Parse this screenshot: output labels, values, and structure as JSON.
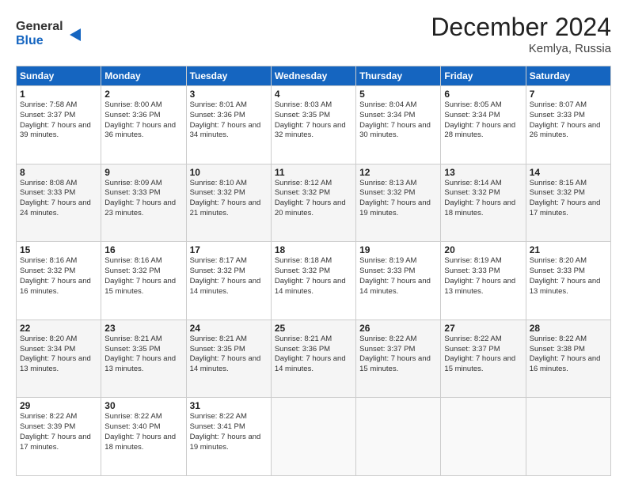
{
  "header": {
    "title": "December 2024",
    "location": "Kemlya, Russia",
    "logo_general": "General",
    "logo_blue": "Blue"
  },
  "weekdays": [
    "Sunday",
    "Monday",
    "Tuesday",
    "Wednesday",
    "Thursday",
    "Friday",
    "Saturday"
  ],
  "weeks": [
    [
      {
        "day": "1",
        "sr": "7:58 AM",
        "ss": "3:37 PM",
        "dl": "7 hours and 39 minutes."
      },
      {
        "day": "2",
        "sr": "8:00 AM",
        "ss": "3:36 PM",
        "dl": "7 hours and 36 minutes."
      },
      {
        "day": "3",
        "sr": "8:01 AM",
        "ss": "3:36 PM",
        "dl": "7 hours and 34 minutes."
      },
      {
        "day": "4",
        "sr": "8:03 AM",
        "ss": "3:35 PM",
        "dl": "7 hours and 32 minutes."
      },
      {
        "day": "5",
        "sr": "8:04 AM",
        "ss": "3:34 PM",
        "dl": "7 hours and 30 minutes."
      },
      {
        "day": "6",
        "sr": "8:05 AM",
        "ss": "3:34 PM",
        "dl": "7 hours and 28 minutes."
      },
      {
        "day": "7",
        "sr": "8:07 AM",
        "ss": "3:33 PM",
        "dl": "7 hours and 26 minutes."
      }
    ],
    [
      {
        "day": "8",
        "sr": "8:08 AM",
        "ss": "3:33 PM",
        "dl": "7 hours and 24 minutes."
      },
      {
        "day": "9",
        "sr": "8:09 AM",
        "ss": "3:33 PM",
        "dl": "7 hours and 23 minutes."
      },
      {
        "day": "10",
        "sr": "8:10 AM",
        "ss": "3:32 PM",
        "dl": "7 hours and 21 minutes."
      },
      {
        "day": "11",
        "sr": "8:12 AM",
        "ss": "3:32 PM",
        "dl": "7 hours and 20 minutes."
      },
      {
        "day": "12",
        "sr": "8:13 AM",
        "ss": "3:32 PM",
        "dl": "7 hours and 19 minutes."
      },
      {
        "day": "13",
        "sr": "8:14 AM",
        "ss": "3:32 PM",
        "dl": "7 hours and 18 minutes."
      },
      {
        "day": "14",
        "sr": "8:15 AM",
        "ss": "3:32 PM",
        "dl": "7 hours and 17 minutes."
      }
    ],
    [
      {
        "day": "15",
        "sr": "8:16 AM",
        "ss": "3:32 PM",
        "dl": "7 hours and 16 minutes."
      },
      {
        "day": "16",
        "sr": "8:16 AM",
        "ss": "3:32 PM",
        "dl": "7 hours and 15 minutes."
      },
      {
        "day": "17",
        "sr": "8:17 AM",
        "ss": "3:32 PM",
        "dl": "7 hours and 14 minutes."
      },
      {
        "day": "18",
        "sr": "8:18 AM",
        "ss": "3:32 PM",
        "dl": "7 hours and 14 minutes."
      },
      {
        "day": "19",
        "sr": "8:19 AM",
        "ss": "3:33 PM",
        "dl": "7 hours and 14 minutes."
      },
      {
        "day": "20",
        "sr": "8:19 AM",
        "ss": "3:33 PM",
        "dl": "7 hours and 13 minutes."
      },
      {
        "day": "21",
        "sr": "8:20 AM",
        "ss": "3:33 PM",
        "dl": "7 hours and 13 minutes."
      }
    ],
    [
      {
        "day": "22",
        "sr": "8:20 AM",
        "ss": "3:34 PM",
        "dl": "7 hours and 13 minutes."
      },
      {
        "day": "23",
        "sr": "8:21 AM",
        "ss": "3:35 PM",
        "dl": "7 hours and 13 minutes."
      },
      {
        "day": "24",
        "sr": "8:21 AM",
        "ss": "3:35 PM",
        "dl": "7 hours and 14 minutes."
      },
      {
        "day": "25",
        "sr": "8:21 AM",
        "ss": "3:36 PM",
        "dl": "7 hours and 14 minutes."
      },
      {
        "day": "26",
        "sr": "8:22 AM",
        "ss": "3:37 PM",
        "dl": "7 hours and 15 minutes."
      },
      {
        "day": "27",
        "sr": "8:22 AM",
        "ss": "3:37 PM",
        "dl": "7 hours and 15 minutes."
      },
      {
        "day": "28",
        "sr": "8:22 AM",
        "ss": "3:38 PM",
        "dl": "7 hours and 16 minutes."
      }
    ],
    [
      {
        "day": "29",
        "sr": "8:22 AM",
        "ss": "3:39 PM",
        "dl": "7 hours and 17 minutes."
      },
      {
        "day": "30",
        "sr": "8:22 AM",
        "ss": "3:40 PM",
        "dl": "7 hours and 18 minutes."
      },
      {
        "day": "31",
        "sr": "8:22 AM",
        "ss": "3:41 PM",
        "dl": "7 hours and 19 minutes."
      },
      null,
      null,
      null,
      null
    ]
  ],
  "labels": {
    "sunrise": "Sunrise:",
    "sunset": "Sunset:",
    "daylight": "Daylight:"
  }
}
